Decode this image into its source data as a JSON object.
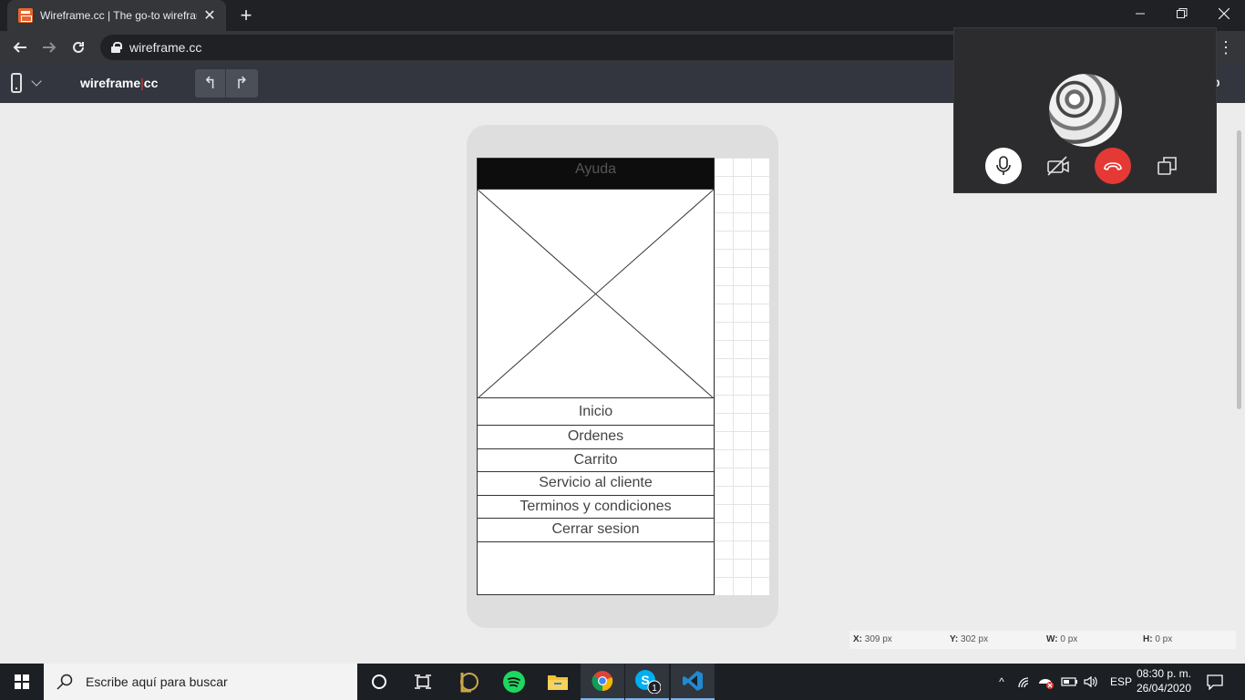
{
  "browser": {
    "tab_title": "Wireframe.cc | The go-to wirefran",
    "url": "wireframe.cc",
    "new_tab": "+",
    "tab_close": "✕"
  },
  "app": {
    "logo_left": "wireframe",
    "logo_sep": "|",
    "logo_right": "cc",
    "undo": "↰",
    "redo": "↱",
    "toolbar_right_partial": "p"
  },
  "wireframe": {
    "header_text": "Ayuda",
    "menu_items": [
      "Inicio",
      "Ordenes",
      "Carrito",
      "Servicio al cliente",
      "Terminos y condiciones",
      "Cerrar sesion"
    ]
  },
  "coords": {
    "x_label": "X:",
    "x_value": "309 px",
    "y_label": "Y:",
    "y_value": "302 px",
    "w_label": "W:",
    "w_value": "0 px",
    "h_label": "H:",
    "h_value": "0 px"
  },
  "call": {
    "colors": {
      "hangup": "#e53935",
      "mic_bg": "#ffffff"
    }
  },
  "taskbar": {
    "search_placeholder": "Escribe aquí para buscar",
    "language": "ESP",
    "time": "08:30 p. m.",
    "date": "26/04/2020",
    "skype_badge": "1"
  }
}
